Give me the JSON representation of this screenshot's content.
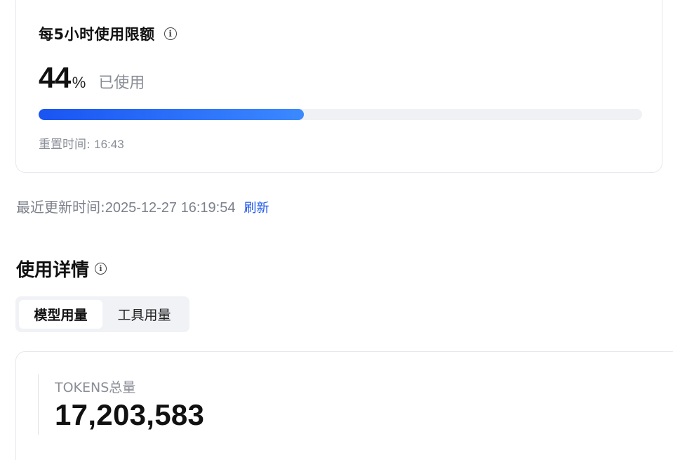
{
  "quota": {
    "title": "每5小时使用限额",
    "info_icon": "info-circle-icon",
    "percent": "44",
    "percent_unit": "%",
    "used_label": "已使用",
    "progress_fraction": 0.44,
    "reset_label": "重置时间:",
    "reset_time": "16:43"
  },
  "update": {
    "label": "最近更新时间:",
    "value": "2025-12-27 16:19:54",
    "refresh_label": "刷新"
  },
  "details": {
    "title": "使用详情",
    "info_icon": "info-circle-icon",
    "tabs": [
      {
        "label": "模型用量",
        "active": true
      },
      {
        "label": "工具用量",
        "active": false
      }
    ],
    "tokens_label": "TOKENS总量",
    "tokens_value": "17,203,583"
  },
  "colors": {
    "accent": "#1d56e8",
    "progress_start": "#1a54f2",
    "progress_end": "#3b89ff",
    "track": "#eff1f5",
    "muted_text": "#8a8e97"
  }
}
